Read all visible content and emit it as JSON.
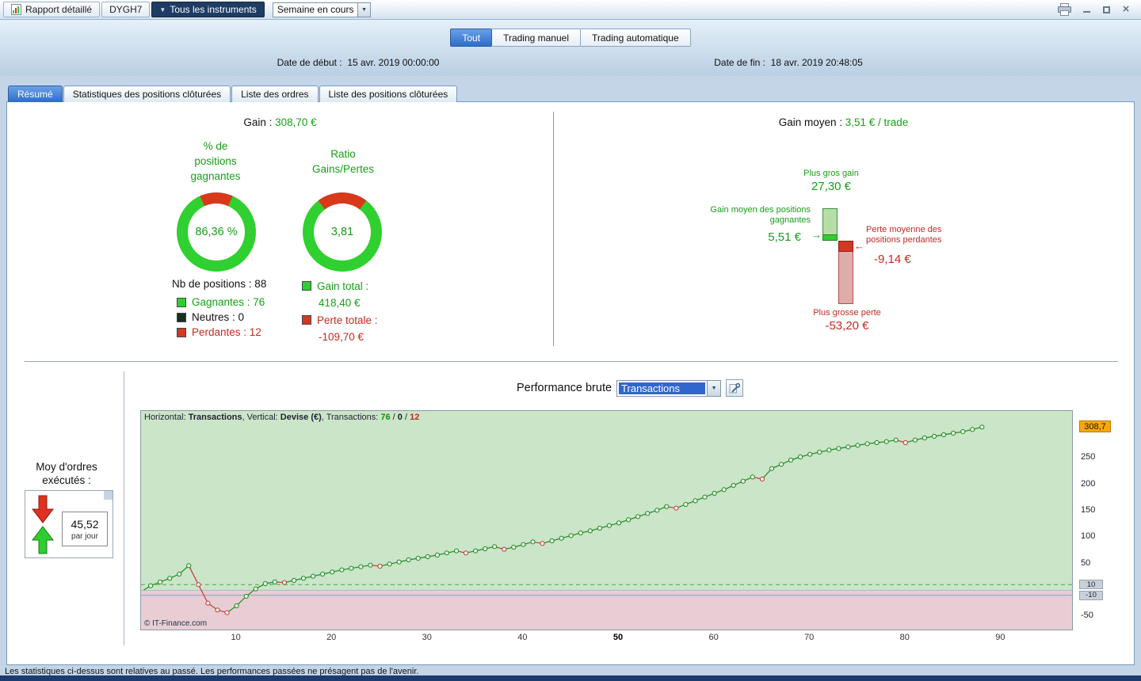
{
  "titlebar": {
    "report_tab": "Rapport détaillé",
    "instrument_tab": "DYGH7",
    "all_instruments_tab": "Tous les instruments",
    "period_value": "Semaine en cours"
  },
  "header": {
    "view_tabs": [
      {
        "label": "Tout",
        "selected": true
      },
      {
        "label": "Trading manuel",
        "selected": false
      },
      {
        "label": "Trading automatique",
        "selected": false
      }
    ],
    "date_start_label": "Date de début :",
    "date_start_value": "15 avr. 2019 00:00:00",
    "date_end_label": "Date de fin :",
    "date_end_value": "18 avr. 2019 20:48:05"
  },
  "tabs": [
    {
      "label": "Résumé",
      "selected": true
    },
    {
      "label": "Statistiques des positions clôturées",
      "selected": false
    },
    {
      "label": "Liste des ordres",
      "selected": false
    },
    {
      "label": "Liste des positions clôturées",
      "selected": false
    }
  ],
  "summary": {
    "gain_label": "Gain :",
    "gain_value": "308,70 €",
    "donut1_title_lines": [
      "% de",
      "positions",
      "gagnantes"
    ],
    "donut1_value": "86,36 %",
    "donut2_title_lines": [
      "Ratio",
      "Gains/Pertes"
    ],
    "donut2_value": "3,81",
    "nb_positions": "Nb de positions : 88",
    "legend": [
      {
        "label": "Gagnantes : 76",
        "swatch": "#2fce2f"
      },
      {
        "label": "Neutres : 0",
        "swatch": "#15301c"
      },
      {
        "label": "Perdantes : 12",
        "swatch": "#d33822"
      }
    ],
    "totals": [
      {
        "label": "Gain total :",
        "value": "418,40 €",
        "swatch": "#2fce2f"
      },
      {
        "label": "Perte totale :",
        "value": "-109,70 €",
        "swatch": "#d33822"
      }
    ],
    "gain_moyen_label": "Gain moyen :",
    "gain_moyen_value": "3,51 € / trade",
    "biggest_gain_label": "Plus gros gain",
    "biggest_gain_value": "27,30 €",
    "avg_win_label_lines": [
      "Gain moyen des positions",
      "gagnantes"
    ],
    "avg_win_value": "5,51 €",
    "avg_loss_label_lines": [
      "Perte moyenne des",
      "positions perdantes"
    ],
    "avg_loss_value": "-9,14 €",
    "biggest_loss_label": "Plus grosse perte",
    "biggest_loss_value": "-53,20 €"
  },
  "performance": {
    "title": "Performance brute",
    "select_value": "Transactions",
    "avg_orders_label_lines": [
      "Moy d'ordres",
      "exécutés :"
    ],
    "avg_orders_value": "45,52",
    "avg_orders_unit": "par jour",
    "plot_header": [
      {
        "text": "Horizontal: ",
        "style": "normal"
      },
      {
        "text": "Transactions",
        "style": "bold"
      },
      {
        "text": ", Vertical: ",
        "style": "normal"
      },
      {
        "text": "Devise (€)",
        "style": "bold"
      },
      {
        "text": ", Transactions: ",
        "style": "normal"
      },
      {
        "text": "76",
        "style": "green"
      },
      {
        "text": " / ",
        "style": "normal"
      },
      {
        "text": "0",
        "style": "dark"
      },
      {
        "text": " / ",
        "style": "normal"
      },
      {
        "text": "12",
        "style": "red"
      }
    ],
    "copyright": "© IT-Finance.com",
    "current_value_label": "308,7"
  },
  "footer": {
    "disclaimer": "Les statistiques ci-dessus sont relatives au passé. Les performances passées ne présagent pas de l'avenir."
  },
  "colors": {
    "accent_blue": "#2e6cc9",
    "positive_green": "#17a017",
    "negative_red": "#c42b22",
    "chart_bg_positive": "#cbe5c9",
    "chart_bg_negative": "#e8ced4",
    "current_value_bg": "#f7a80a",
    "titlebar_dark_tab": "#1e3c64"
  },
  "chart_data": [
    {
      "type": "pie",
      "title": "% de positions gagnantes",
      "value": 86.36,
      "value_label": "86,36 %",
      "percent_green": 86.36,
      "percent_red": 13.64
    },
    {
      "type": "pie",
      "title": "Ratio Gains/Pertes",
      "value": 3.81,
      "value_label": "3,81",
      "percent_green": 79.2,
      "percent_red": 20.8
    },
    {
      "type": "bar",
      "title": "Gain moyen : 3,51 € / trade",
      "bars": [
        {
          "name": "Plus gros gain",
          "value": 27.3,
          "label": "27,30 €"
        },
        {
          "name": "Gain moyen des positions gagnantes",
          "value": 5.51,
          "label": "5,51 €"
        },
        {
          "name": "Perte moyenne des positions perdantes",
          "value": -9.14,
          "label": "-9,14 €"
        },
        {
          "name": "Plus grosse perte",
          "value": -53.2,
          "label": "-53,20 €"
        }
      ]
    },
    {
      "type": "line",
      "title": "Performance brute",
      "xlabel": "Transactions",
      "ylabel": "Devise (€)",
      "wins": 76,
      "neutral": 0,
      "losses": 12,
      "start_value": 0,
      "current_value": 308.7,
      "values": [
        8,
        15,
        22,
        30,
        46,
        10,
        -25,
        -38,
        -43,
        -30,
        -12,
        2,
        12,
        15,
        14,
        18,
        22,
        26,
        30,
        34,
        38,
        41,
        44,
        47,
        45,
        49,
        53,
        57,
        60,
        63,
        66,
        70,
        74,
        70,
        74,
        78,
        82,
        77,
        81,
        86,
        91,
        88,
        93,
        98,
        103,
        108,
        112,
        117,
        122,
        127,
        133,
        139,
        145,
        151,
        158,
        155,
        162,
        169,
        176,
        183,
        190,
        198,
        206,
        214,
        210,
        230,
        238,
        246,
        252,
        257,
        261,
        265,
        268,
        271,
        274,
        277,
        279,
        281,
        284,
        279,
        284,
        288,
        291,
        294,
        297,
        300,
        304,
        308.7
      ],
      "y_ticks": [
        250,
        200,
        150,
        100,
        50,
        -50
      ],
      "threshold_ticks": [
        10,
        -10
      ],
      "x_ticks": [
        10,
        20,
        30,
        40,
        50,
        60,
        70,
        80,
        90
      ],
      "bold_tick": 50,
      "xlim": [
        0,
        97.5
      ],
      "ylim": [
        -75,
        339
      ],
      "grid": false,
      "legend_position": "none"
    }
  ]
}
